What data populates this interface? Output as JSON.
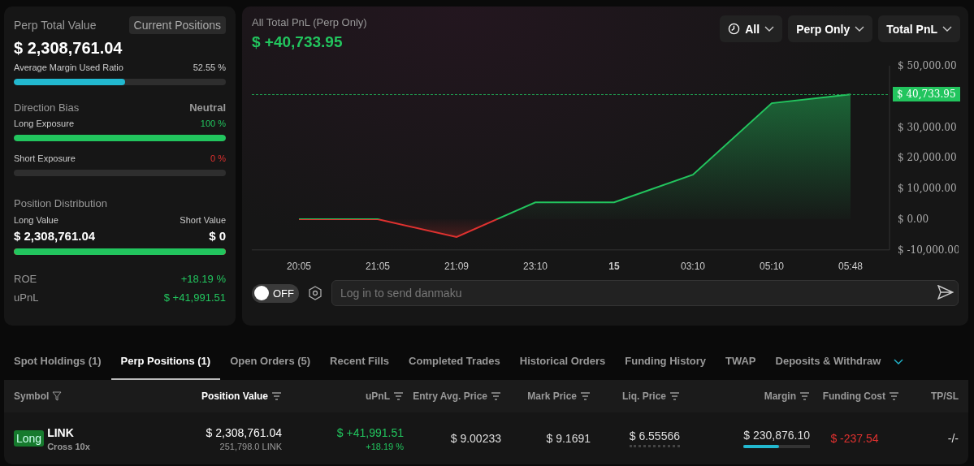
{
  "summary": {
    "title": "Perp Total Value",
    "badge": "Current Positions",
    "total": "$ 2,308,761.04",
    "margin_ratio": {
      "label": "Average Margin Used Ratio",
      "reading": "52.55 %",
      "level": 0.5255
    },
    "direction": {
      "label": "Direction Bias",
      "value": "Neutral"
    },
    "exposures": [
      {
        "kind": "long",
        "label": "Long Exposure",
        "reading": "100 %",
        "level": 1
      },
      {
        "kind": "short",
        "label": "Short Exposure",
        "reading": "0 %",
        "level": 0
      }
    ],
    "distribution": {
      "label": "Position Distribution",
      "long_label": "Long Value",
      "short_label": "Short Value",
      "long_value": "$ 2,308,761.04",
      "short_value": "$ 0",
      "level": 1
    },
    "stats": [
      {
        "label": "ROE",
        "value": "+18.19 %"
      },
      {
        "label": "uPnL",
        "value": "$ +41,991.51"
      }
    ]
  },
  "pnl": {
    "title": "All Total PnL (Perp Only)",
    "value": "$ +40,733.95",
    "filters": [
      {
        "label": "All"
      },
      {
        "label": "Perp Only"
      },
      {
        "label": "Total PnL"
      }
    ],
    "chart_data": {
      "type": "area",
      "categories": [
        "20:05",
        "21:05",
        "21:09",
        "23:10",
        "15",
        "03:10",
        "05:10",
        "05:48"
      ],
      "series": [
        {
          "color": "#22c55e",
          "values": [
            0,
            0,
            -5800,
            5500,
            5500,
            14500,
            37800,
            40700
          ]
        }
      ],
      "ylim": [
        -10000,
        50000
      ],
      "yticks": [
        {
          "value": 50000,
          "label": "$ 50,000.00"
        },
        {
          "value": 30000,
          "label": "$ 30,000.00"
        },
        {
          "value": 20000,
          "label": "$ 20,000.00"
        },
        {
          "value": 10000,
          "label": "$ 10,000.00"
        },
        {
          "value": 0,
          "label": "$ 0.00"
        },
        {
          "value": -10000,
          "label": "$ -10,000.00"
        }
      ]
    },
    "price_tag": "$ 40,733.95",
    "danmaku": {
      "toggle_label": "OFF",
      "on": false,
      "placeholder": "Log in to send danmaku"
    }
  },
  "tabs": [
    {
      "label": "Spot Holdings (1)",
      "selected": false
    },
    {
      "label": "Perp Positions (1)",
      "selected": true
    },
    {
      "label": "Open Orders (5)",
      "selected": false
    },
    {
      "label": "Recent Fills",
      "selected": false
    },
    {
      "label": "Completed Trades",
      "selected": false
    },
    {
      "label": "Historical Orders",
      "selected": false
    },
    {
      "label": "Funding History",
      "selected": false
    },
    {
      "label": "TWAP",
      "selected": false
    },
    {
      "label": "Deposits & Withdraw",
      "selected": false
    }
  ],
  "table": {
    "columns": [
      {
        "label": "Symbol",
        "active": false
      },
      {
        "label": "Position Value",
        "active": true
      },
      {
        "label": "uPnL",
        "active": false
      },
      {
        "label": "Entry Avg. Price",
        "active": false
      },
      {
        "label": "Mark Price",
        "active": false
      },
      {
        "label": "Liq. Price",
        "active": false
      },
      {
        "label": "Margin",
        "active": false
      },
      {
        "label": "Funding Cost",
        "active": false
      },
      {
        "label": "TP/SL",
        "active": false
      }
    ],
    "rows": [
      {
        "side": "Long",
        "symbol": "LINK",
        "mode": "Cross 10x",
        "position_value": "$ 2,308,761.04",
        "size": "251,798.0 LINK",
        "upnl": "$ +41,991.51",
        "roe": "+18.19 %",
        "entry": "$ 9.00233",
        "mark": "$ 9.1691",
        "liq": "$ 6.55566",
        "margin": {
          "value": "$ 230,876.10",
          "level": 0.54
        },
        "funding": "$ -237.54",
        "tpsl": "-/-"
      }
    ]
  }
}
